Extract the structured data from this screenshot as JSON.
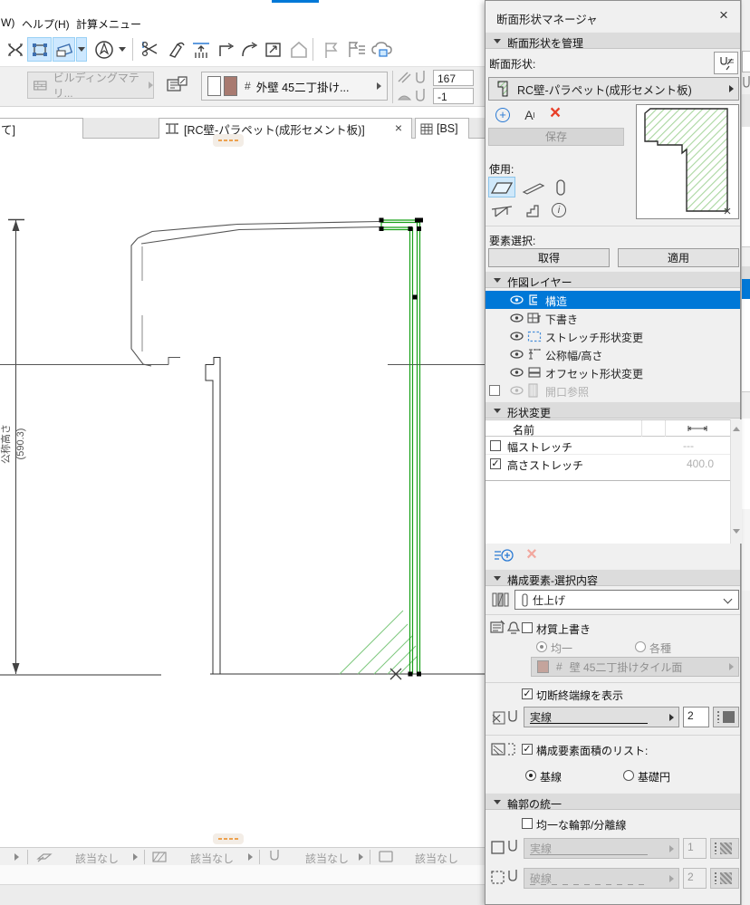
{
  "accent": "#0078d7",
  "green_line": "#18a018",
  "green_hatch": "#a9d69f",
  "menubar": {
    "fragment": "W)",
    "help": "ヘルプ(H)",
    "calc": "計算メニュー"
  },
  "toolbar2": {
    "building_material": "ビルディングマテリ...",
    "hash": "#",
    "fill_name": "外壁  45二丁掛け...",
    "pen_value_top": "167",
    "pen_value_bottom": "-1"
  },
  "tabs": {
    "left_partial": "て]",
    "active": "[RC壁-パラペット(成形セメント板)]",
    "bs": "[BS]"
  },
  "canvas": {
    "dim_name": "公称高さ",
    "dim_value": "(590.3)"
  },
  "statusbar": {
    "items": [
      {
        "label": "該当なし"
      },
      {
        "label": "該当なし"
      },
      {
        "label": "該当なし"
      },
      {
        "label": "該当なし"
      }
    ]
  },
  "palette": {
    "title": "断面形状マネージャ",
    "manage": {
      "header": "断面形状を管理",
      "profile_label": "断面形状:",
      "profile_name": "RC壁-パラペット(成形セメント板)",
      "save": "保存",
      "use_label": "使用:"
    },
    "selection": {
      "label": "要素選択:",
      "get": "取得",
      "apply": "適用"
    },
    "layers": {
      "header": "作図レイヤー",
      "items": [
        {
          "label": "構造"
        },
        {
          "label": "下書き"
        },
        {
          "label": "ストレッチ形状変更"
        },
        {
          "label": "公称幅/高さ"
        },
        {
          "label": "オフセット形状変更"
        },
        {
          "label": "開口参照"
        }
      ]
    },
    "modifiers": {
      "header": "形状変更",
      "col_name": "名前",
      "rows": [
        {
          "checked": false,
          "label": "幅ストレッチ",
          "value": "---"
        },
        {
          "checked": true,
          "label": "高さストレッチ",
          "value": "400.0"
        }
      ]
    },
    "component": {
      "header": "構成要素-選択内容",
      "combo_value": "仕上げ",
      "material_override": "材質上書き",
      "uniform": "均一",
      "various": "各種",
      "material_hash": "#",
      "material_name": "壁  45二丁掛けタイル面"
    },
    "cutline": {
      "checkbox": "切断終端線を表示",
      "line_type": "実線",
      "pen": "2"
    },
    "arealist": {
      "checkbox": "構成要素面積のリスト:",
      "baseline": "基線",
      "basecircle": "基礎円"
    },
    "outline": {
      "header": "輪郭の統一",
      "uniform_checkbox": "均一な輪郭/分離線",
      "line1": "実線",
      "pen1": "1",
      "line2": "破線",
      "pen2": "2"
    }
  },
  "icons": {
    "check": "✓",
    "close": "×",
    "delete_x": "×",
    "rename_a": "A",
    "rename_sup": "I",
    "plus": "+",
    "info": "i"
  }
}
